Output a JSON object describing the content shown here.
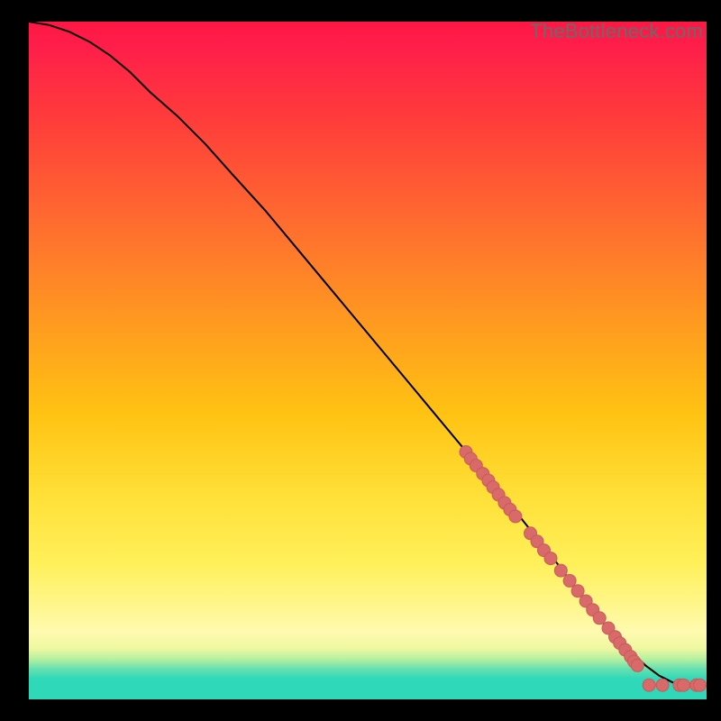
{
  "watermark": "TheBottleneck.com",
  "chart_data": {
    "type": "line",
    "title": "",
    "xlabel": "",
    "ylabel": "",
    "xlim": [
      0,
      100
    ],
    "ylim": [
      0,
      100
    ],
    "curve": {
      "x": [
        0,
        3,
        6,
        9,
        12,
        15,
        18,
        22,
        26,
        30,
        35,
        40,
        45,
        50,
        55,
        60,
        65,
        70,
        74,
        78,
        81,
        83,
        85,
        87,
        89,
        91,
        93,
        95,
        97,
        99,
        100
      ],
      "y": [
        100,
        99.5,
        98.5,
        97,
        95,
        92.5,
        89.5,
        86,
        82,
        77.5,
        72,
        66,
        60,
        54,
        48,
        42,
        36,
        30,
        25,
        20,
        16,
        13,
        11,
        9,
        7,
        5,
        3.5,
        2.5,
        2,
        2,
        2
      ]
    },
    "points": {
      "x": [
        64.5,
        65.2,
        66.0,
        67.0,
        67.8,
        68.5,
        69.3,
        70.2,
        71.0,
        71.8,
        74.0,
        75.0,
        76.0,
        77.0,
        78.5,
        79.8,
        81.0,
        82.2,
        83.2,
        84.2,
        85.5,
        86.5,
        87.2,
        88.0,
        88.8,
        89.3,
        89.8,
        91.5,
        93.5,
        96.0,
        96.6,
        98.5,
        99.0
      ],
      "y": [
        36.5,
        35.5,
        34.5,
        33.3,
        32.3,
        31.3,
        30.2,
        29.0,
        28.0,
        27.0,
        24.5,
        23.3,
        22.0,
        20.8,
        19.0,
        17.5,
        16.0,
        14.5,
        13.2,
        12.0,
        10.5,
        9.2,
        8.3,
        7.3,
        6.3,
        5.6,
        5.0,
        2.1,
        2.1,
        2.1,
        2.1,
        2.1,
        2.1
      ]
    },
    "colors": {
      "curve": "#000000",
      "points_fill": "#d96a6a",
      "points_stroke": "#c95a5a",
      "gradient_top": "#ff1744",
      "gradient_bottom": "#2fd8b8"
    }
  }
}
